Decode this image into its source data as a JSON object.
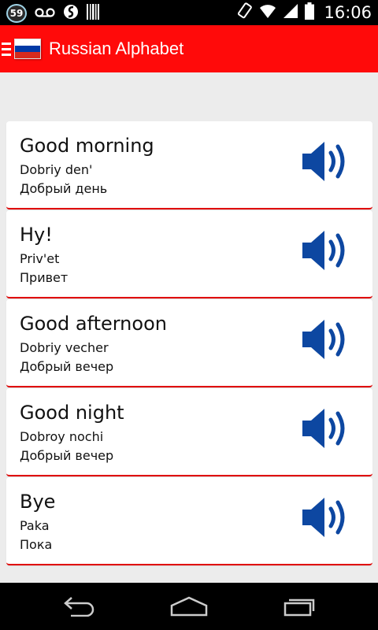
{
  "status_bar": {
    "notification_count": "59",
    "time": "16:06",
    "icons": [
      "voicemail-icon",
      "sync-icon",
      "barcode-icon",
      "screen-rotation-icon",
      "wifi-icon",
      "signal-icon",
      "battery-icon"
    ]
  },
  "action_bar": {
    "title": "Russian Alphabet",
    "flag_colors": [
      "#ffffff",
      "#0039a6",
      "#d52b1e"
    ],
    "background": "#ff0a0a"
  },
  "phrases": [
    {
      "english": "Good morning",
      "transliteration": "Dobriy den'",
      "russian": "Добрый день"
    },
    {
      "english": "Hy!",
      "transliteration": "Priv'et",
      "russian": "Привет"
    },
    {
      "english": "Good afternoon",
      "transliteration": "Dobriy vecher",
      "russian": "Добрый вечер"
    },
    {
      "english": "Good night",
      "transliteration": "Dobroy nochi",
      "russian": "Добрый вечер"
    },
    {
      "english": "Bye",
      "transliteration": "Paka",
      "russian": "Пока"
    }
  ],
  "colors": {
    "speaker": "#0d47a1",
    "card_border": "#e00000"
  },
  "nav_bar": {
    "icons": [
      "back-icon",
      "home-icon",
      "recent-apps-icon"
    ]
  }
}
